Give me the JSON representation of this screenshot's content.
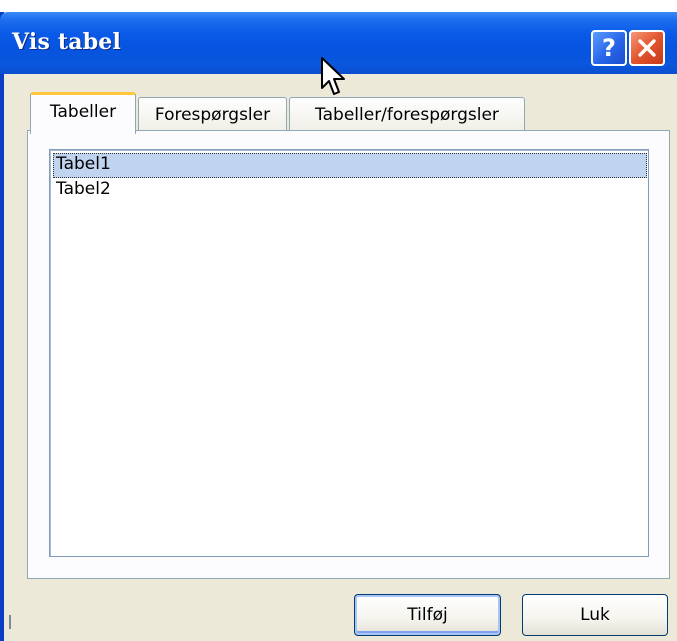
{
  "window": {
    "title": "Vis tabel",
    "help_glyph": "?",
    "close_icon": "close-x-icon"
  },
  "tabs": [
    {
      "label": "Tabeller",
      "active": true
    },
    {
      "label": "Forespørgsler",
      "active": false
    },
    {
      "label": "Tabeller/forespørgsler",
      "active": false
    }
  ],
  "list": {
    "items": [
      {
        "label": "Tabel1",
        "selected": true
      },
      {
        "label": "Tabel2",
        "selected": false
      }
    ]
  },
  "buttons": {
    "add_label": "Tilføj",
    "close_label": "Luk"
  },
  "colors": {
    "title_bar": "#0654df",
    "dialog_face": "#ece9d8",
    "selection": "#c0d4f0",
    "active_tab_accent": "#ffc83c",
    "close_button": "#e2552e"
  }
}
